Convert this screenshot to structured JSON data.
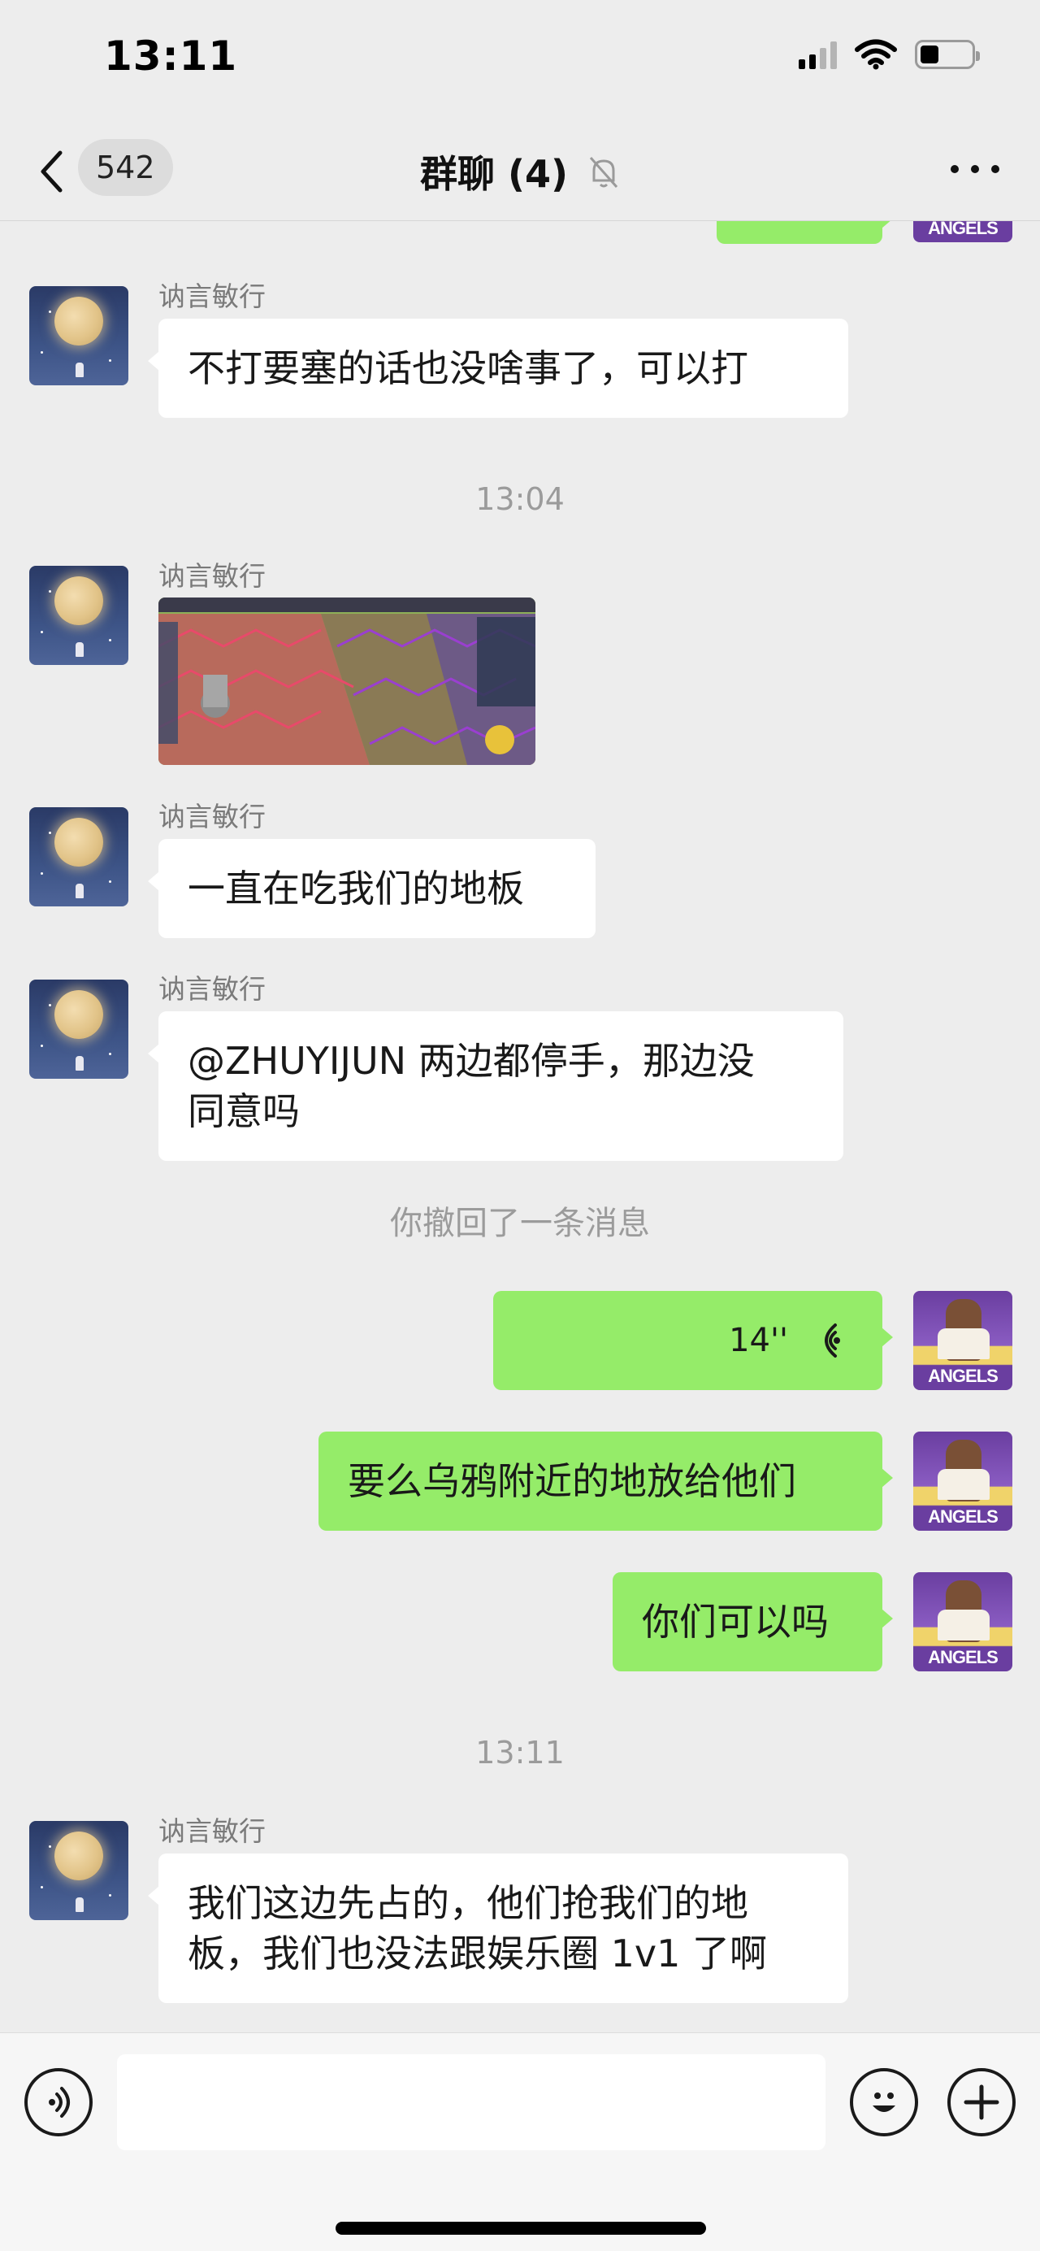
{
  "status_bar": {
    "time": "13:11"
  },
  "nav": {
    "unread_count": "542",
    "title": "群聊 (4)",
    "icons": {
      "back": "chevron-left-icon",
      "mute": "bell-off-icon",
      "more": "more-dots-icon"
    }
  },
  "messages": {
    "m1": {
      "sender": "讷言敏行",
      "text": "不打要塞的话也没啥事了，可以打"
    },
    "ts1": "13:04",
    "m2": {
      "sender": "讷言敏行",
      "type": "image"
    },
    "m3": {
      "sender": "讷言敏行",
      "text": "一直在吃我们的地板"
    },
    "m4": {
      "sender": "讷言敏行",
      "line1": "@ZHUYIJUN 两边都停手，那边没",
      "line2": "同意吗"
    },
    "recalled": "你撤回了一条消息",
    "voice": {
      "duration": "14''"
    },
    "out1": "要么乌鸦附近的地放给他们",
    "out2": "你们可以吗",
    "ts2": "13:11",
    "m5": {
      "sender": "讷言敏行",
      "line1": "我们这边先占的，他们抢我们的地",
      "line2": "板，我们也没法跟娱乐圈 1v1 了啊"
    }
  },
  "self_avatar_label": "ANGELS",
  "input_bar": {
    "icons": {
      "voice": "voice-input-icon",
      "emoji": "emoji-icon",
      "add": "plus-icon"
    }
  },
  "colors": {
    "outgoing_bubble": "#95ec69",
    "incoming_bubble": "#ffffff",
    "background": "#ededed"
  }
}
